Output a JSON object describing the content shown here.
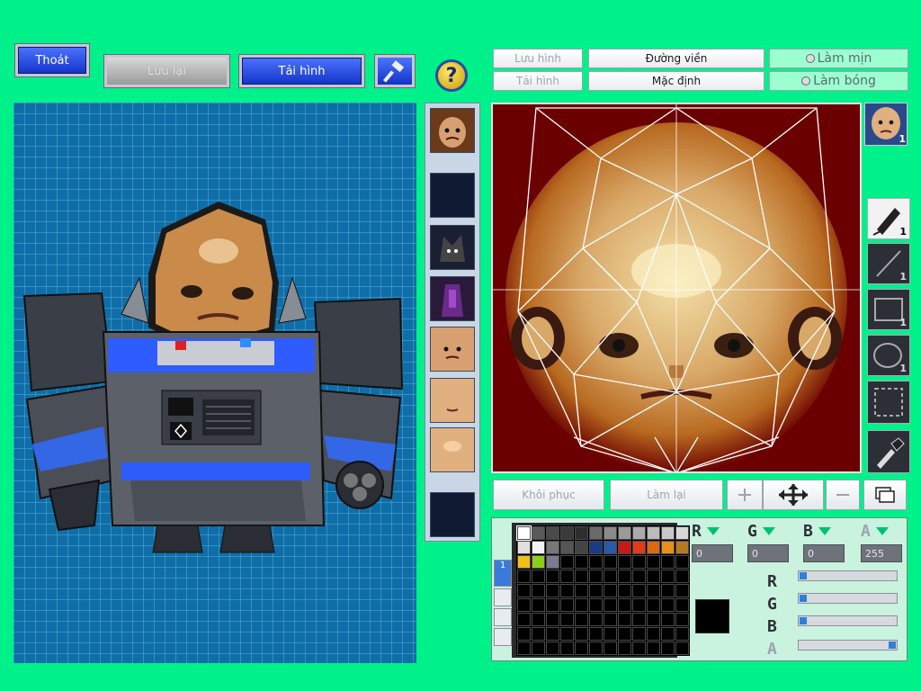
{
  "top_left": {
    "exit_label": "Thoát",
    "save_label": "Lưu lại",
    "reload_label": "Tải hình"
  },
  "help": {
    "label": "?"
  },
  "texture_toolbar": {
    "save_image": "Lưu hình",
    "load_image": "Tải hình",
    "outline": "Đường viền",
    "default": "Mặc định",
    "smooth": "Làm mịn",
    "shine": "Làm bóng"
  },
  "thumbs": [
    "face-1",
    "dark",
    "wolf",
    "purple",
    "face-2",
    "face-3",
    "face-4",
    "dark-2"
  ],
  "selected_part_badge": "1",
  "tools": [
    {
      "name": "pen-tool",
      "size": "1",
      "active": true
    },
    {
      "name": "line-tool",
      "size": "1",
      "active": false
    },
    {
      "name": "rect-tool",
      "size": "1",
      "active": false
    },
    {
      "name": "ellipse-tool",
      "size": "1",
      "active": false
    },
    {
      "name": "select-tool",
      "size": "",
      "active": false
    },
    {
      "name": "eyedropper-tool",
      "size": "",
      "active": false
    }
  ],
  "bottom_actions": {
    "restore": "Khôi phục",
    "redo": "Làm lại"
  },
  "color": {
    "channels": [
      "R",
      "G",
      "B",
      "A"
    ],
    "values": [
      "0",
      "0",
      "0",
      "255"
    ],
    "slider_levels": [
      0,
      0,
      0,
      1
    ],
    "current_hex": "#000000"
  },
  "palette_tab_label": "1",
  "palette_colors": [
    "#ffffff",
    "#5a5a5a",
    "#4a4a4a",
    "#3a3a3a",
    "#2e2e2e",
    "#6a6a6a",
    "#8a8a8a",
    "#9a9a9a",
    "#aaaaaa",
    "#bbbbbb",
    "#c8c8c8",
    "#d8d8d8",
    "#e0e0e0",
    "#f2f2f2",
    "#777777",
    "#555555",
    "#444444",
    "#1a3a8a",
    "#2a5aa8",
    "#c81818",
    "#e03a1a",
    "#d86a10",
    "#e89018",
    "#b87a20",
    "#f0c018",
    "#8ad018",
    "#7a7a90"
  ],
  "colors": {
    "bg": "#00f08a",
    "viewer_bg": "#0f6ea8",
    "texture_bg": "#6a0000",
    "accent_blue": "#1433c8"
  }
}
